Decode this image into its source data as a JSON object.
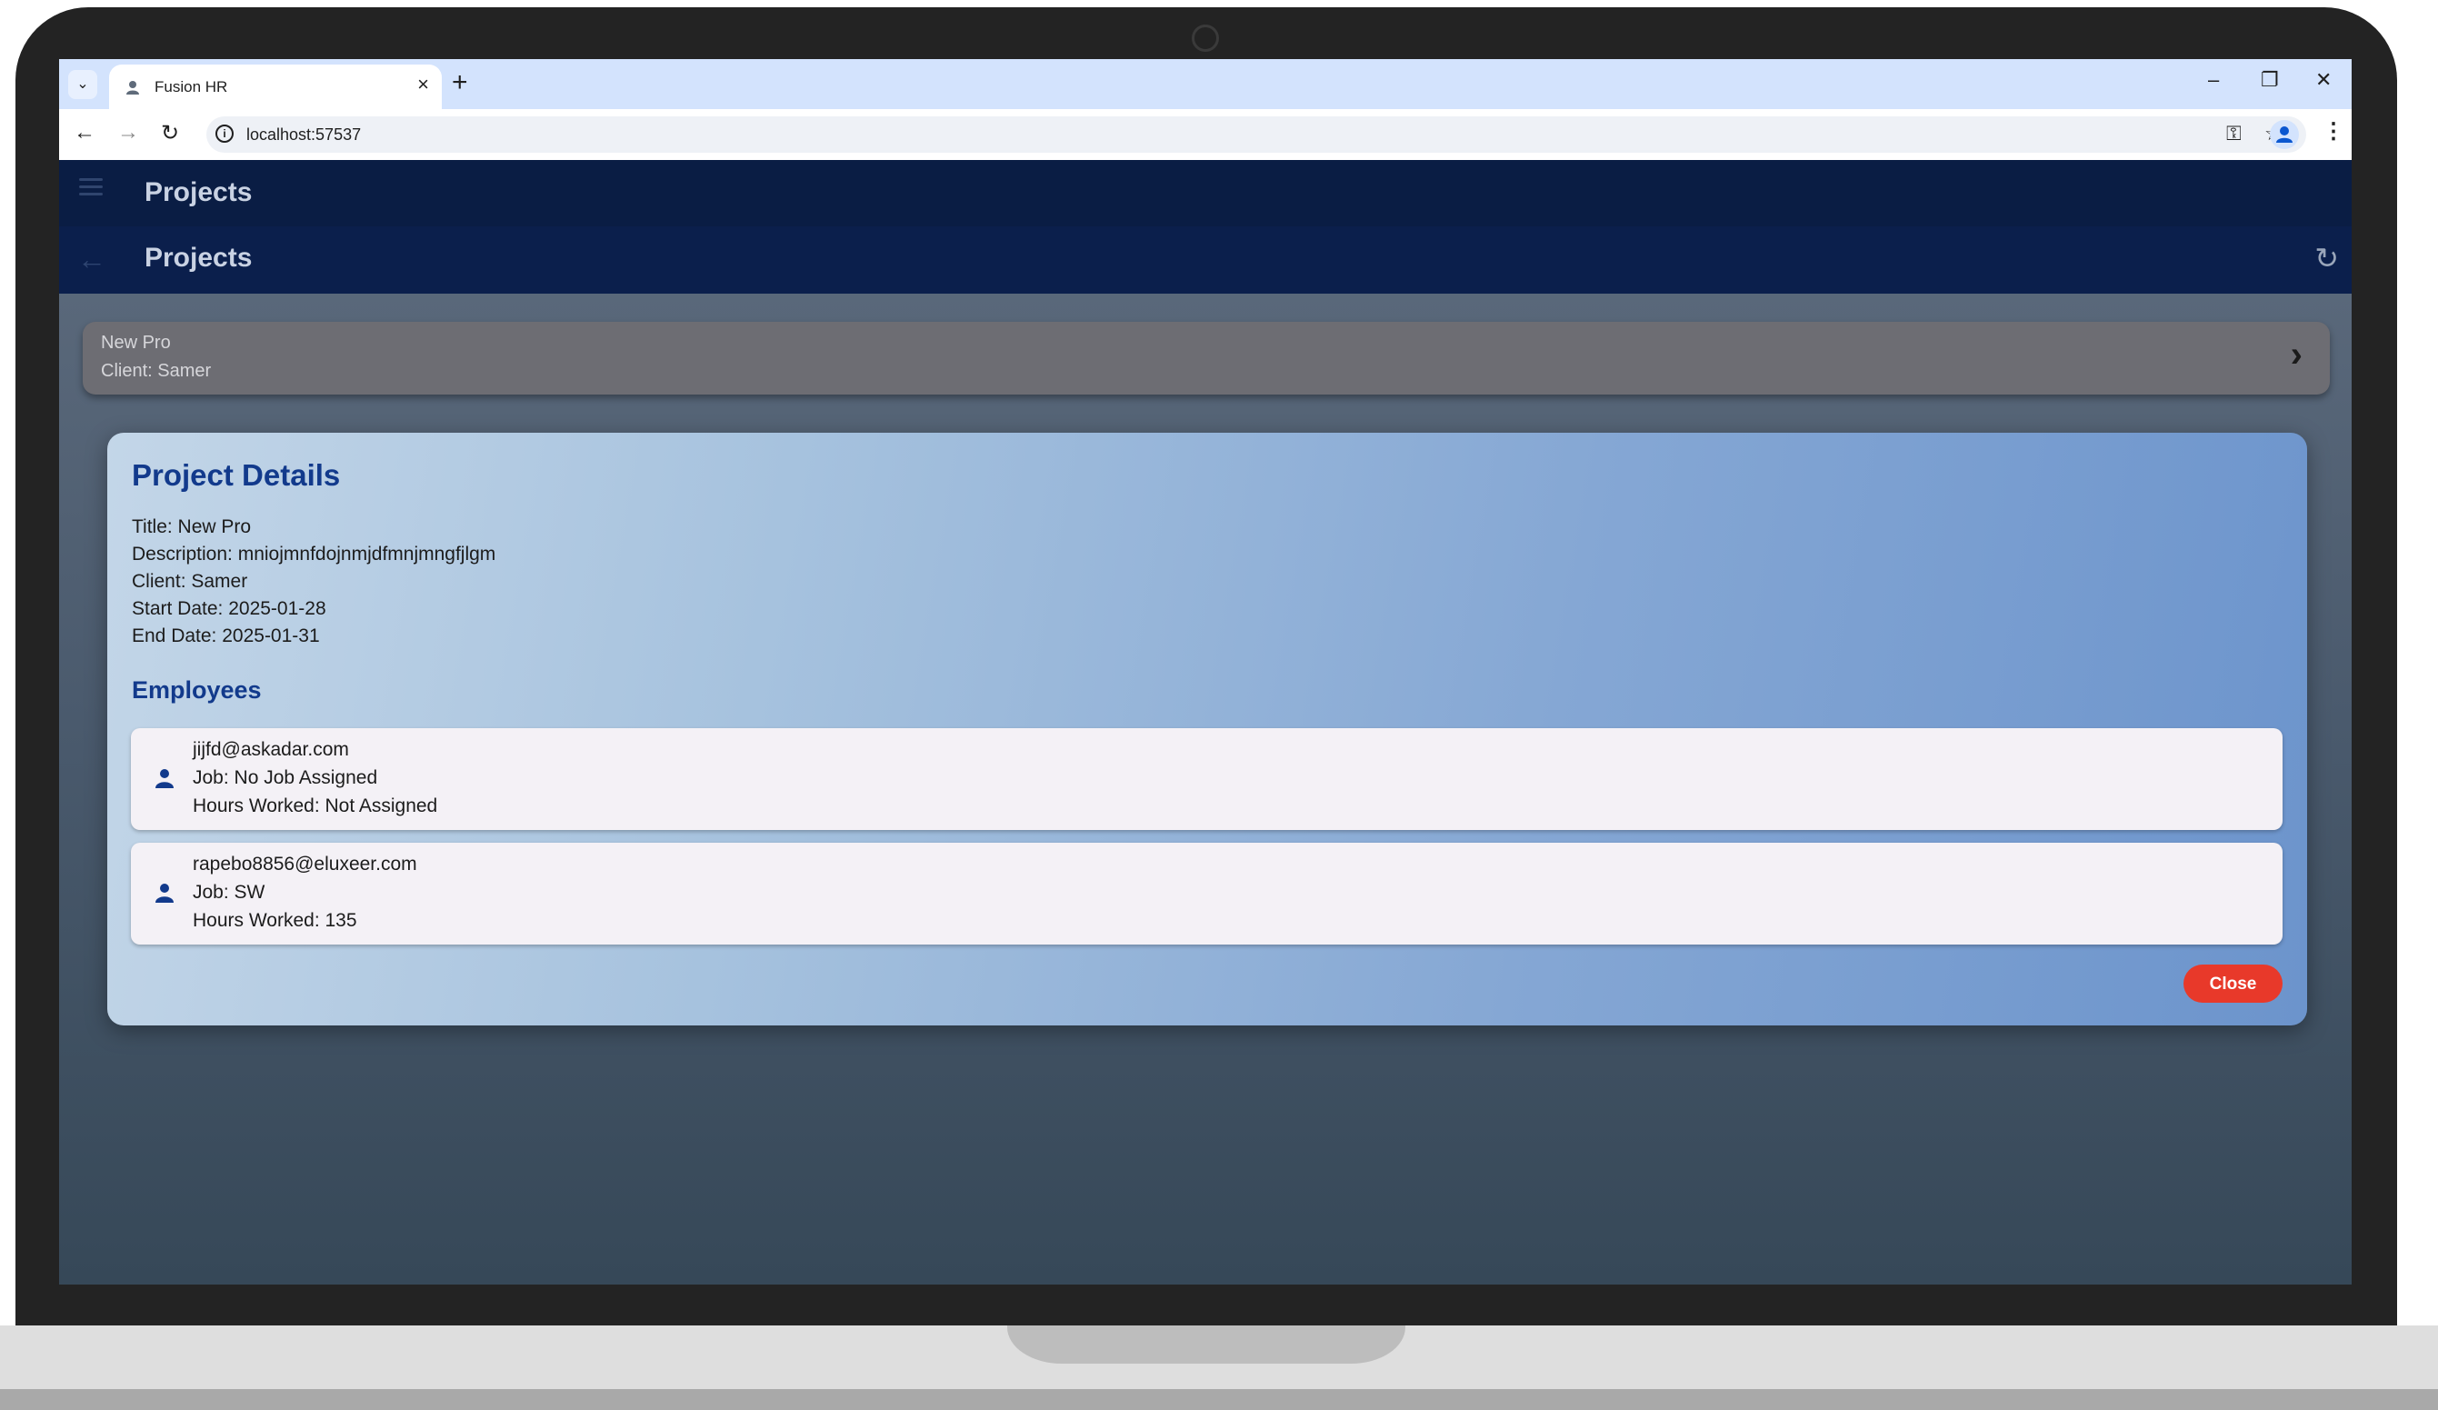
{
  "browser": {
    "tab_title": "Fusion HR",
    "tab_close": "×",
    "new_tab": "+",
    "url": "localhost:57537",
    "tab_list_icon": "⌄",
    "window_controls": {
      "minimize": "–",
      "restore": "❐",
      "close": "✕"
    },
    "nav": {
      "back": "←",
      "forward": "→",
      "reload": "↻"
    },
    "icons": {
      "password": "⚿",
      "bookmark": "☆",
      "menu": "⋮"
    }
  },
  "app": {
    "appbar_title": "Projects",
    "page_title": "Projects",
    "icons": {
      "back": "←",
      "refresh": "↻",
      "chevron": "›"
    },
    "project_item": {
      "title": "New Pro",
      "client": "Client: Samer"
    },
    "dialog": {
      "title": "Project Details",
      "fields": [
        "Title: New Pro",
        "Description: mniojmnfdojnmjdfmnjmngfjlgm",
        "Client: Samer",
        "Start Date: 2025-01-28",
        "End Date: 2025-01-31"
      ],
      "employees_heading": "Employees",
      "employees": [
        {
          "email": "jijfd@askadar.com",
          "job": "Job: No Job Assigned",
          "hours": "Hours Worked: Not Assigned"
        },
        {
          "email": "rapebo8856@eluxeer.com",
          "job": "Job: SW",
          "hours": "Hours Worked: 135"
        }
      ],
      "close_label": "Close"
    }
  },
  "colors": {
    "appbar": "#0a1d44",
    "dialog_heading": "#123a8c",
    "close_button": "#e8392a"
  }
}
